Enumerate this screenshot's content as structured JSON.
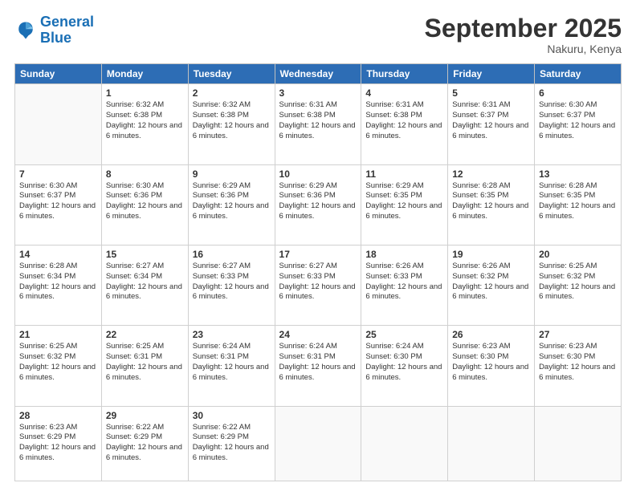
{
  "logo": {
    "line1": "General",
    "line2": "Blue"
  },
  "header": {
    "month": "September 2025",
    "location": "Nakuru, Kenya"
  },
  "days_of_week": [
    "Sunday",
    "Monday",
    "Tuesday",
    "Wednesday",
    "Thursday",
    "Friday",
    "Saturday"
  ],
  "weeks": [
    [
      {
        "day": "",
        "sunrise": "",
        "sunset": "",
        "daylight": ""
      },
      {
        "day": "1",
        "sunrise": "Sunrise: 6:32 AM",
        "sunset": "Sunset: 6:38 PM",
        "daylight": "Daylight: 12 hours and 6 minutes."
      },
      {
        "day": "2",
        "sunrise": "Sunrise: 6:32 AM",
        "sunset": "Sunset: 6:38 PM",
        "daylight": "Daylight: 12 hours and 6 minutes."
      },
      {
        "day": "3",
        "sunrise": "Sunrise: 6:31 AM",
        "sunset": "Sunset: 6:38 PM",
        "daylight": "Daylight: 12 hours and 6 minutes."
      },
      {
        "day": "4",
        "sunrise": "Sunrise: 6:31 AM",
        "sunset": "Sunset: 6:38 PM",
        "daylight": "Daylight: 12 hours and 6 minutes."
      },
      {
        "day": "5",
        "sunrise": "Sunrise: 6:31 AM",
        "sunset": "Sunset: 6:37 PM",
        "daylight": "Daylight: 12 hours and 6 minutes."
      },
      {
        "day": "6",
        "sunrise": "Sunrise: 6:30 AM",
        "sunset": "Sunset: 6:37 PM",
        "daylight": "Daylight: 12 hours and 6 minutes."
      }
    ],
    [
      {
        "day": "7",
        "sunrise": "Sunrise: 6:30 AM",
        "sunset": "Sunset: 6:37 PM",
        "daylight": "Daylight: 12 hours and 6 minutes."
      },
      {
        "day": "8",
        "sunrise": "Sunrise: 6:30 AM",
        "sunset": "Sunset: 6:36 PM",
        "daylight": "Daylight: 12 hours and 6 minutes."
      },
      {
        "day": "9",
        "sunrise": "Sunrise: 6:29 AM",
        "sunset": "Sunset: 6:36 PM",
        "daylight": "Daylight: 12 hours and 6 minutes."
      },
      {
        "day": "10",
        "sunrise": "Sunrise: 6:29 AM",
        "sunset": "Sunset: 6:36 PM",
        "daylight": "Daylight: 12 hours and 6 minutes."
      },
      {
        "day": "11",
        "sunrise": "Sunrise: 6:29 AM",
        "sunset": "Sunset: 6:35 PM",
        "daylight": "Daylight: 12 hours and 6 minutes."
      },
      {
        "day": "12",
        "sunrise": "Sunrise: 6:28 AM",
        "sunset": "Sunset: 6:35 PM",
        "daylight": "Daylight: 12 hours and 6 minutes."
      },
      {
        "day": "13",
        "sunrise": "Sunrise: 6:28 AM",
        "sunset": "Sunset: 6:35 PM",
        "daylight": "Daylight: 12 hours and 6 minutes."
      }
    ],
    [
      {
        "day": "14",
        "sunrise": "Sunrise: 6:28 AM",
        "sunset": "Sunset: 6:34 PM",
        "daylight": "Daylight: 12 hours and 6 minutes."
      },
      {
        "day": "15",
        "sunrise": "Sunrise: 6:27 AM",
        "sunset": "Sunset: 6:34 PM",
        "daylight": "Daylight: 12 hours and 6 minutes."
      },
      {
        "day": "16",
        "sunrise": "Sunrise: 6:27 AM",
        "sunset": "Sunset: 6:33 PM",
        "daylight": "Daylight: 12 hours and 6 minutes."
      },
      {
        "day": "17",
        "sunrise": "Sunrise: 6:27 AM",
        "sunset": "Sunset: 6:33 PM",
        "daylight": "Daylight: 12 hours and 6 minutes."
      },
      {
        "day": "18",
        "sunrise": "Sunrise: 6:26 AM",
        "sunset": "Sunset: 6:33 PM",
        "daylight": "Daylight: 12 hours and 6 minutes."
      },
      {
        "day": "19",
        "sunrise": "Sunrise: 6:26 AM",
        "sunset": "Sunset: 6:32 PM",
        "daylight": "Daylight: 12 hours and 6 minutes."
      },
      {
        "day": "20",
        "sunrise": "Sunrise: 6:25 AM",
        "sunset": "Sunset: 6:32 PM",
        "daylight": "Daylight: 12 hours and 6 minutes."
      }
    ],
    [
      {
        "day": "21",
        "sunrise": "Sunrise: 6:25 AM",
        "sunset": "Sunset: 6:32 PM",
        "daylight": "Daylight: 12 hours and 6 minutes."
      },
      {
        "day": "22",
        "sunrise": "Sunrise: 6:25 AM",
        "sunset": "Sunset: 6:31 PM",
        "daylight": "Daylight: 12 hours and 6 minutes."
      },
      {
        "day": "23",
        "sunrise": "Sunrise: 6:24 AM",
        "sunset": "Sunset: 6:31 PM",
        "daylight": "Daylight: 12 hours and 6 minutes."
      },
      {
        "day": "24",
        "sunrise": "Sunrise: 6:24 AM",
        "sunset": "Sunset: 6:31 PM",
        "daylight": "Daylight: 12 hours and 6 minutes."
      },
      {
        "day": "25",
        "sunrise": "Sunrise: 6:24 AM",
        "sunset": "Sunset: 6:30 PM",
        "daylight": "Daylight: 12 hours and 6 minutes."
      },
      {
        "day": "26",
        "sunrise": "Sunrise: 6:23 AM",
        "sunset": "Sunset: 6:30 PM",
        "daylight": "Daylight: 12 hours and 6 minutes."
      },
      {
        "day": "27",
        "sunrise": "Sunrise: 6:23 AM",
        "sunset": "Sunset: 6:30 PM",
        "daylight": "Daylight: 12 hours and 6 minutes."
      }
    ],
    [
      {
        "day": "28",
        "sunrise": "Sunrise: 6:23 AM",
        "sunset": "Sunset: 6:29 PM",
        "daylight": "Daylight: 12 hours and 6 minutes."
      },
      {
        "day": "29",
        "sunrise": "Sunrise: 6:22 AM",
        "sunset": "Sunset: 6:29 PM",
        "daylight": "Daylight: 12 hours and 6 minutes."
      },
      {
        "day": "30",
        "sunrise": "Sunrise: 6:22 AM",
        "sunset": "Sunset: 6:29 PM",
        "daylight": "Daylight: 12 hours and 6 minutes."
      },
      {
        "day": "",
        "sunrise": "",
        "sunset": "",
        "daylight": ""
      },
      {
        "day": "",
        "sunrise": "",
        "sunset": "",
        "daylight": ""
      },
      {
        "day": "",
        "sunrise": "",
        "sunset": "",
        "daylight": ""
      },
      {
        "day": "",
        "sunrise": "",
        "sunset": "",
        "daylight": ""
      }
    ]
  ]
}
